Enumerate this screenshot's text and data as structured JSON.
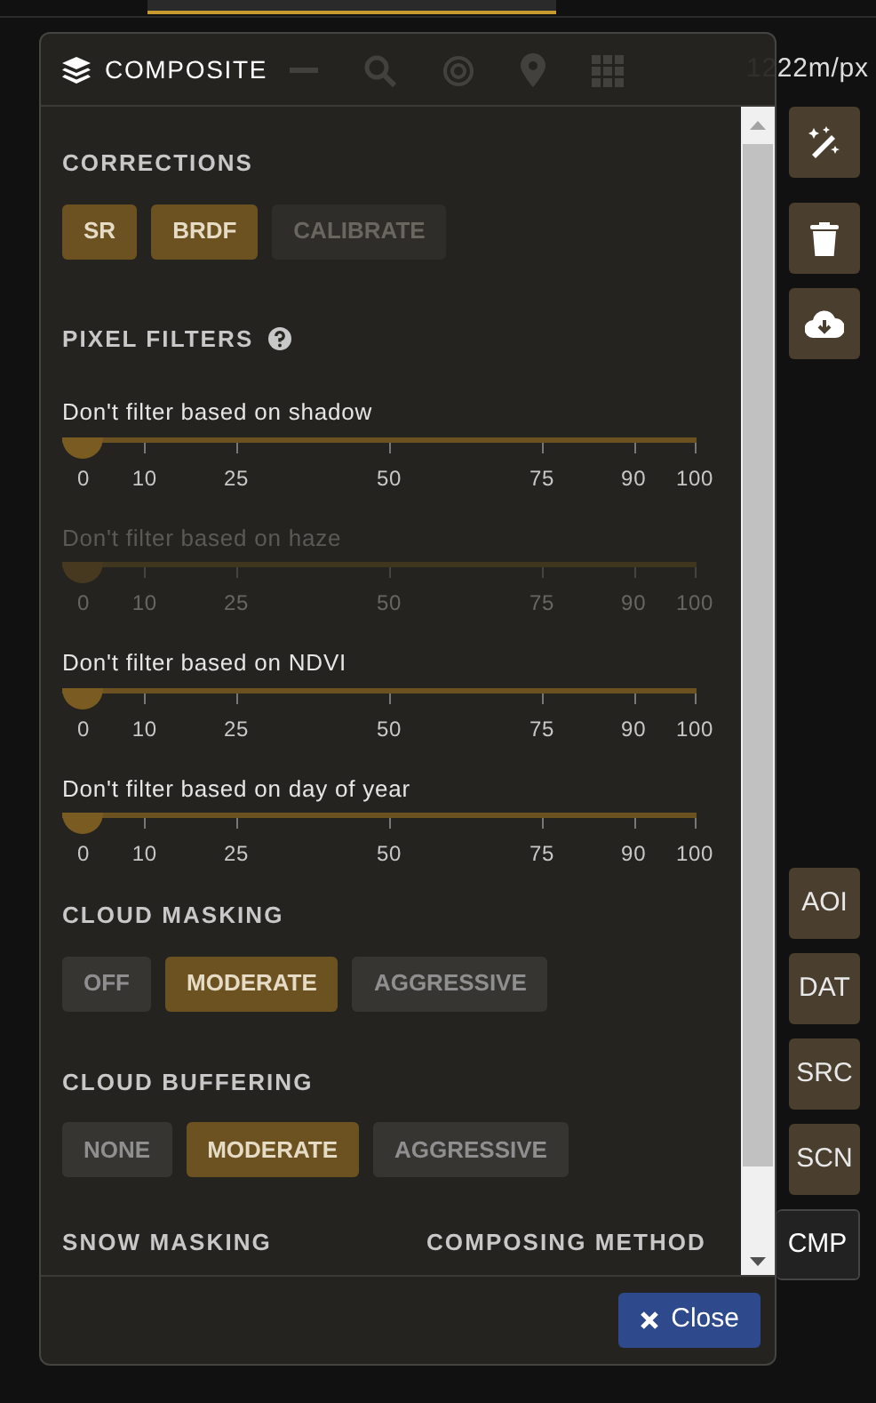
{
  "scale_text": "1222m/px",
  "dialog": {
    "title": "COMPOSITE",
    "corrections": {
      "title": "CORRECTIONS",
      "options": [
        {
          "label": "SR",
          "selected": true,
          "disabled": false
        },
        {
          "label": "BRDF",
          "selected": true,
          "disabled": false
        },
        {
          "label": "CALIBRATE",
          "selected": false,
          "disabled": true
        }
      ]
    },
    "pixel_filters": {
      "title": "PIXEL FILTERS",
      "filters": [
        {
          "label": "Don't filter based on shadow",
          "level": 0,
          "disabled": false,
          "ticks": [
            "0",
            "10",
            "25",
            "50",
            "75",
            "90",
            "100"
          ]
        },
        {
          "label": "Don't filter based on haze",
          "level": 0,
          "disabled": true,
          "ticks": [
            "0",
            "10",
            "25",
            "50",
            "75",
            "90",
            "100"
          ]
        },
        {
          "label": "Don't filter based on NDVI",
          "level": 0,
          "disabled": false,
          "ticks": [
            "0",
            "10",
            "25",
            "50",
            "75",
            "90",
            "100"
          ]
        },
        {
          "label": "Don't filter based on day of year",
          "level": 0,
          "disabled": false,
          "ticks": [
            "0",
            "10",
            "25",
            "50",
            "75",
            "90",
            "100"
          ]
        }
      ]
    },
    "cloud_masking": {
      "title": "CLOUD MASKING",
      "options": [
        {
          "label": "OFF",
          "selected": false
        },
        {
          "label": "MODERATE",
          "selected": true
        },
        {
          "label": "AGGRESSIVE",
          "selected": false
        }
      ]
    },
    "cloud_buffering": {
      "title": "CLOUD BUFFERING",
      "options": [
        {
          "label": "NONE",
          "selected": false
        },
        {
          "label": "MODERATE",
          "selected": true
        },
        {
          "label": "AGGRESSIVE",
          "selected": false
        }
      ]
    },
    "snow_masking": {
      "title": "SNOW MASKING"
    },
    "composing_method": {
      "title": "COMPOSING METHOD"
    },
    "close_button": "Close"
  },
  "side_buttons": [
    {
      "label": "AOI",
      "selected": false
    },
    {
      "label": "DAT",
      "selected": false
    },
    {
      "label": "SRC",
      "selected": false
    },
    {
      "label": "SCN",
      "selected": false
    },
    {
      "label": "CMP",
      "selected": true
    }
  ]
}
